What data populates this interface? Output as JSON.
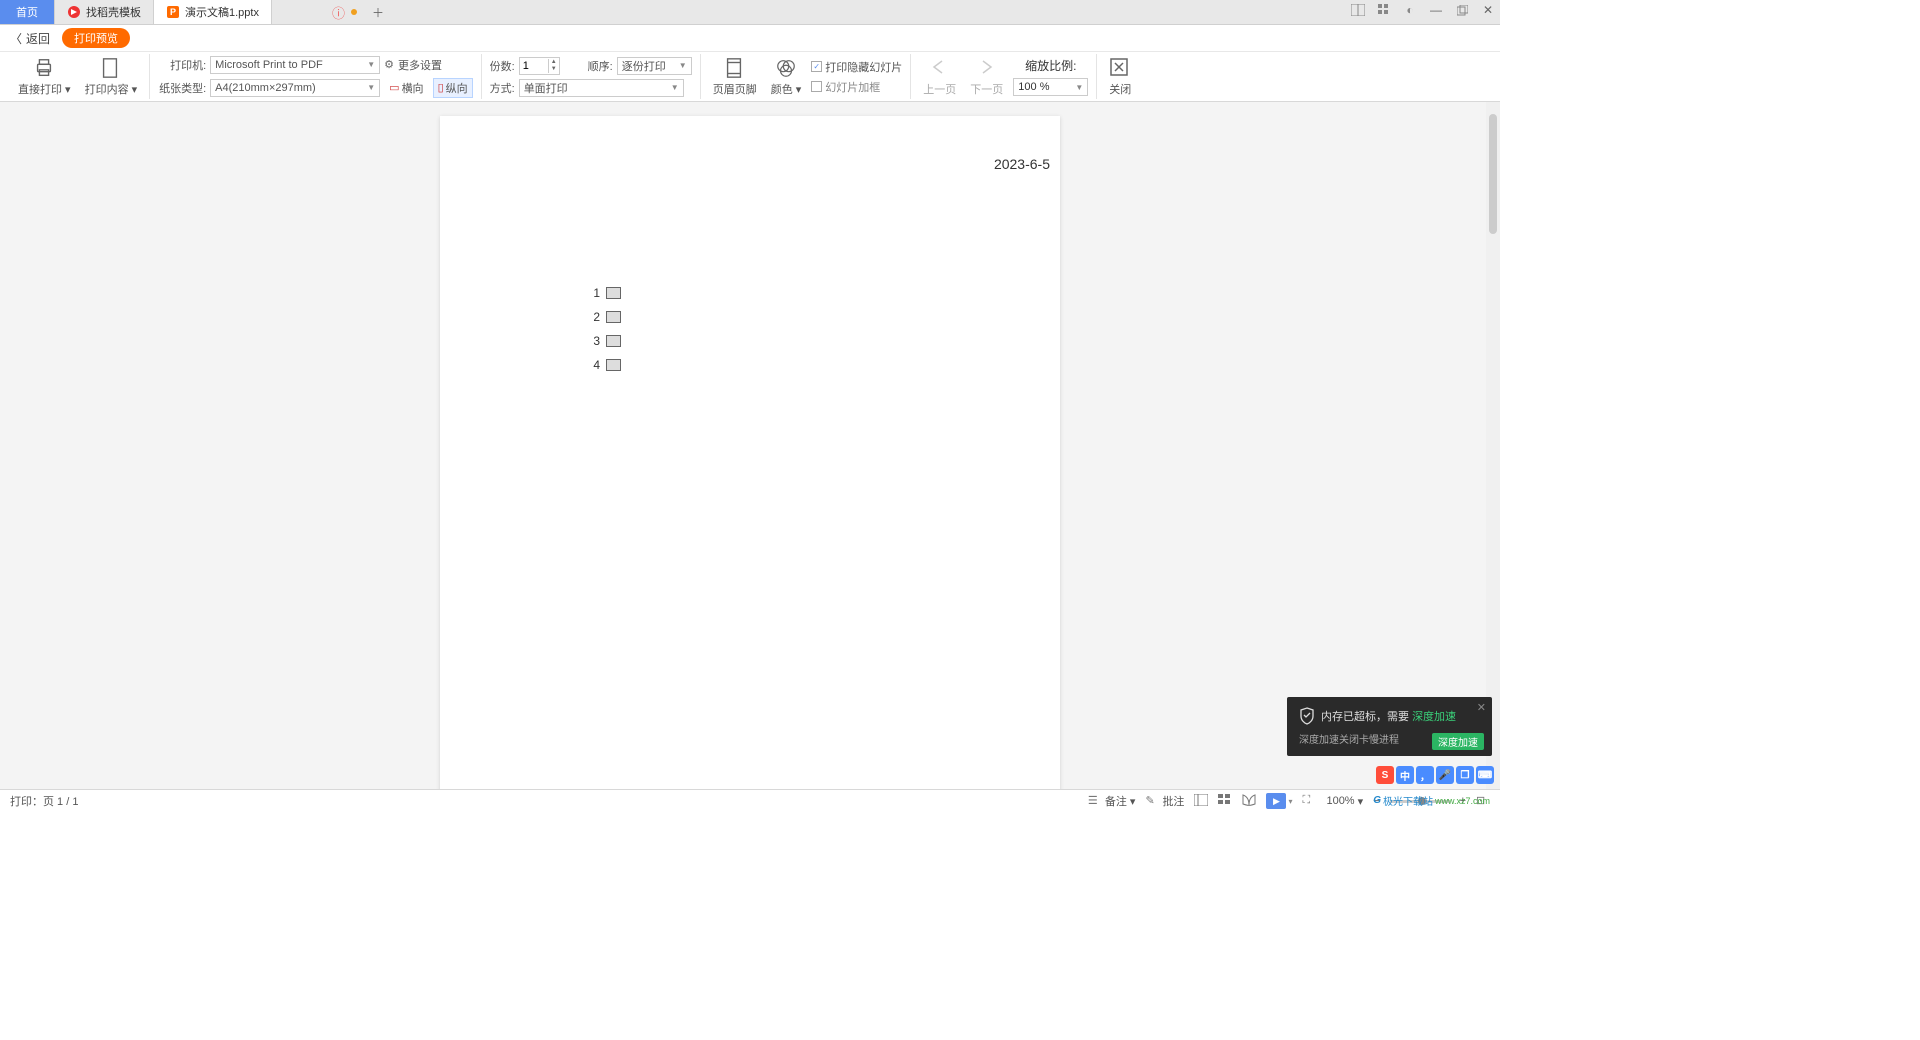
{
  "tabs": {
    "home": "首页",
    "tpl": "找稻壳模板",
    "doc": "演示文稿1.pptx"
  },
  "back_label": "返回",
  "print_preview_badge": "打印预览",
  "ribbon": {
    "direct_print": "直接打印",
    "print_content": "打印内容",
    "printer_label": "打印机:",
    "printer_value": "Microsoft Print to PDF",
    "paper_label": "纸张类型:",
    "paper_value": "A4(210mm×297mm)",
    "more_settings": "更多设置",
    "landscape": "横向",
    "portrait": "纵向",
    "copies_label": "份数:",
    "copies_value": "1",
    "order_label": "顺序:",
    "order_value": "逐份打印",
    "mode_label": "方式:",
    "mode_value": "单面打印",
    "header_footer": "页眉页脚",
    "color": "颜色",
    "chk_hidden": "打印隐藏幻灯片",
    "chk_frame": "幻灯片加框",
    "prev_page": "上一页",
    "next_page": "下一页",
    "zoom_label": "缩放比例:",
    "zoom_value": "100 %",
    "close": "关闭"
  },
  "preview": {
    "date": "2023-6-5",
    "items": [
      "1",
      "2",
      "3",
      "4"
    ]
  },
  "status": {
    "page_info": "打印：页 1 / 1",
    "notes": "备注",
    "comments": "批注",
    "zoom": "100%"
  },
  "notif": {
    "msg_prefix": "内存已超标，需要",
    "msg_highlight": "深度加速",
    "sub": "深度加速关闭卡慢进程",
    "btn": "深度加速"
  },
  "ime": [
    "中",
    "，",
    "●",
    "❐",
    "⌨"
  ],
  "watermark": {
    "name": "极光下载站",
    "url": "www.xz7.com"
  }
}
